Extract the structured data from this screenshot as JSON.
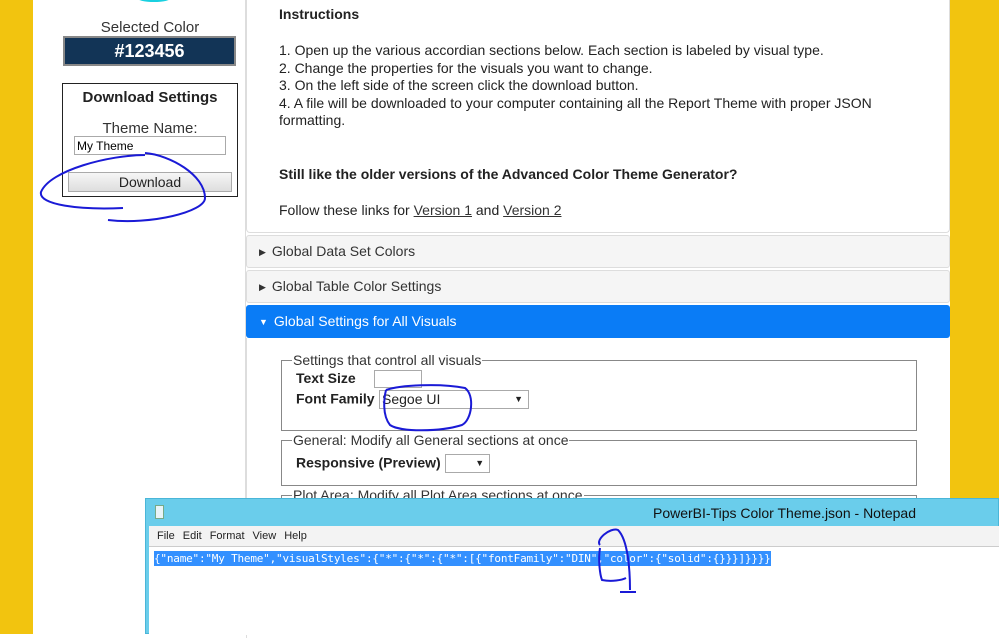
{
  "left_panel": {
    "selected_color_label": "Selected Color",
    "selected_color_value": "#123456",
    "download_settings": {
      "title": "Download Settings",
      "theme_name_label": "Theme Name:",
      "theme_name_value": "My Theme",
      "download_button": "Download"
    }
  },
  "instructions": {
    "title": "Instructions",
    "steps": [
      "1. Open up the various accordian sections below. Each section is labeled by visual type.",
      "2. Change the properties for the visuals you want to change.",
      "3. On the left side of the screen click the download button.",
      "4. A file will be downloaded to your computer containing all the Report Theme with proper JSON formatting."
    ],
    "older_heading": "Still like the older versions of the Advanced Color Theme Generator?",
    "links_prefix": "Follow these links for ",
    "link1": "Version 1",
    "links_mid": " and ",
    "link2": "Version 2"
  },
  "accordions": [
    {
      "label": "Global Data Set Colors",
      "expanded": false
    },
    {
      "label": "Global Table Color Settings",
      "expanded": false
    },
    {
      "label": "Global Settings for All Visuals",
      "expanded": true
    }
  ],
  "global_settings": {
    "fieldset1": {
      "legend": "Settings that control all visuals",
      "text_size_label": "Text Size",
      "text_size_value": "",
      "font_family_label": "Font Family",
      "font_family_value": "Segoe UI"
    },
    "fieldset2": {
      "legend": "General: Modify all General sections at once",
      "responsive_label": "Responsive (Preview)",
      "responsive_value": ""
    },
    "fieldset3": {
      "legend": "Plot Area: Modify all Plot Area sections at once"
    }
  },
  "notepad": {
    "title": "PowerBI-Tips Color Theme.json - Notepad",
    "menu": [
      "File",
      "Edit",
      "Format",
      "View",
      "Help"
    ],
    "content": "{\"name\":\"My Theme\",\"visualStyles\":{\"*\":{\"*\":{\"*\":[{\"fontFamily\":\"DIN\",\"color\":{\"solid\":{}}}]}}}}"
  },
  "colors": {
    "accent": "#0a7cf6",
    "selected": "#123456",
    "frame": "#f2c40f",
    "annotation": "#1a1ad6"
  }
}
